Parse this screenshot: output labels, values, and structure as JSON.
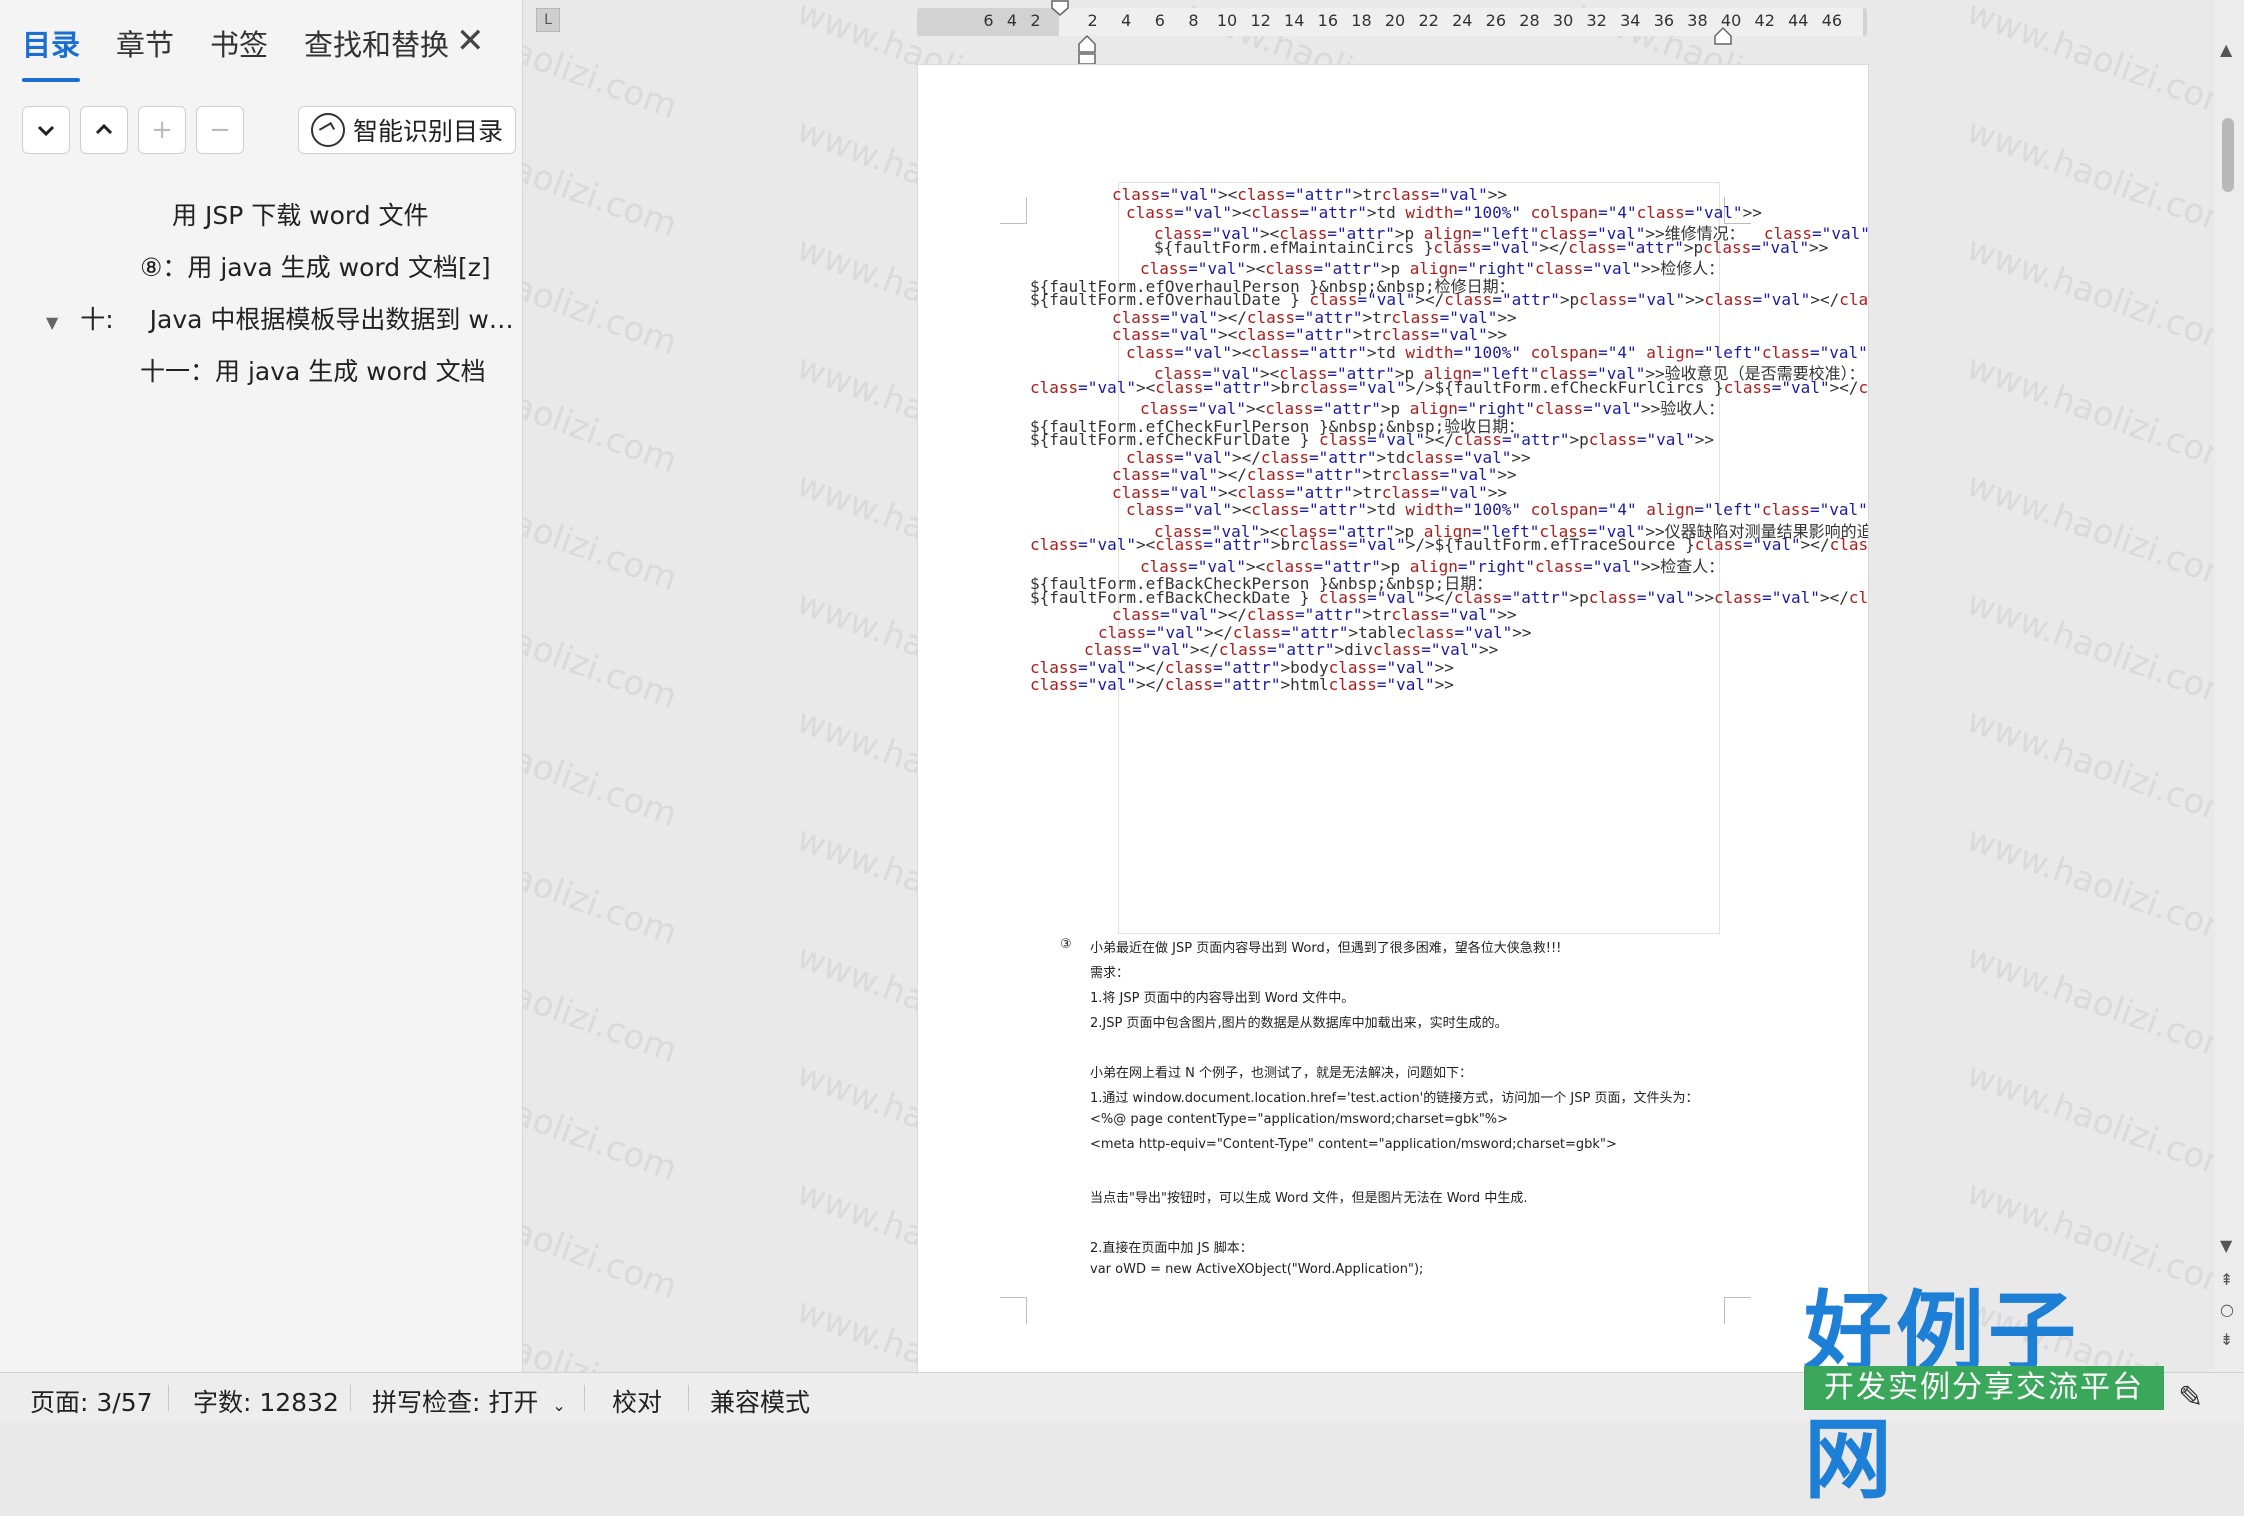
{
  "nav": {
    "tabs": [
      "目录",
      "章节",
      "书签",
      "查找和替换"
    ],
    "active_tab": "目录",
    "smart_button_label": "智能识别目录",
    "toc": [
      {
        "label": "用 JSP 下载 word 文件"
      },
      {
        "label": "⑧：用 java 生成 word 文档[z]"
      },
      {
        "prefix": "十:",
        "label": "Java 中根据模板导出数据到 w…"
      },
      {
        "label": "十一：用 java 生成 word 文档"
      }
    ]
  },
  "ruler": {
    "left_numbers": [
      "6",
      "4",
      "2"
    ],
    "right_numbers": [
      "2",
      "4",
      "6",
      "8",
      "10",
      "12",
      "14",
      "16",
      "18",
      "20",
      "22",
      "24",
      "26",
      "28",
      "30",
      "32",
      "34",
      "36",
      "38",
      "40",
      "42",
      "44",
      "46"
    ]
  },
  "code_lines": [
    "<tr>",
    "<td width=\"100%\" colspan=\"4\">",
    "<p align=\"left\">维修情况：  <br/>",
    "${faultForm.efMaintainCircs }</p>",
    "<p align=\"right\">检修人：",
    "${faultForm.efOverhaulPerson }&nbsp;&nbsp;检修日期：",
    "${faultForm.efOverhaulDate } </p></td>",
    "</tr>",
    "<tr>",
    "<td width=\"100%\" colspan=\"4\" align=\"left\">",
    "<p align=\"left\">验收意见（是否需要校准）：",
    "<br/>${faultForm.efCheckFurlCircs }</p>",
    "<p align=\"right\">验收人：",
    "${faultForm.efCheckFurlPerson }&nbsp;&nbsp;验收日期：",
    "${faultForm.efCheckFurlDate } </p>",
    "</td>",
    "</tr>",
    "<tr>",
    "<td width=\"100%\" colspan=\"4\" align=\"left\">",
    "<p align=\"left\">仪器缺陷对测量结果影响的追溯：",
    "<br/>${faultForm.efTraceSource }</p>",
    "<p align=\"right\">检查人：",
    "${faultForm.efBackCheckPerson }&nbsp;&nbsp;日期：",
    "${faultForm.efBackCheckDate } </p></td>",
    "</tr>",
    "</table>",
    "</div>",
    "</body>",
    "</html>"
  ],
  "para_marker": "③",
  "para_lines": [
    "小弟最近在做 JSP 页面内容导出到 Word，但遇到了很多困难，望各位大侠急救!!!",
    "需求：",
    "1.将 JSP 页面中的内容导出到 Word 文件中。",
    "2.JSP 页面中包含图片,图片的数据是从数据库中加载出来，实时生成的。",
    "",
    "小弟在网上看过 N 个例子，也测试了，就是无法解决，问题如下：",
    "1.通过 window.document.location.href='test.action'的链接方式，访问加一个 JSP 页面，文件头为：",
    "<%@ page contentType=\"application/msword;charset=gbk\"%>",
    "<meta http-equiv=\"Content-Type\" content=\"application/msword;charset=gbk\">",
    "",
    "当点击\"导出\"按钮时，可以生成 Word 文件，但是图片无法在 Word 中生成.",
    "",
    "2.直接在页面中加 JS 脚本：",
    "var oWD = new ActiveXObject(\"Word.Application\");"
  ],
  "status": {
    "page": "页面: 3/57",
    "words": "字数: 12832",
    "spell": "拼写检查: 打开",
    "proof": "校对",
    "compat": "兼容模式"
  },
  "watermark": "www.haolizi.com",
  "logo": {
    "title": "好例子网",
    "subtitle": "开发实例分享交流平台"
  },
  "colors": {
    "accent": "#1b6fd1",
    "logo_blue": "#1e7fd6",
    "logo_green": "#3aa75a"
  }
}
